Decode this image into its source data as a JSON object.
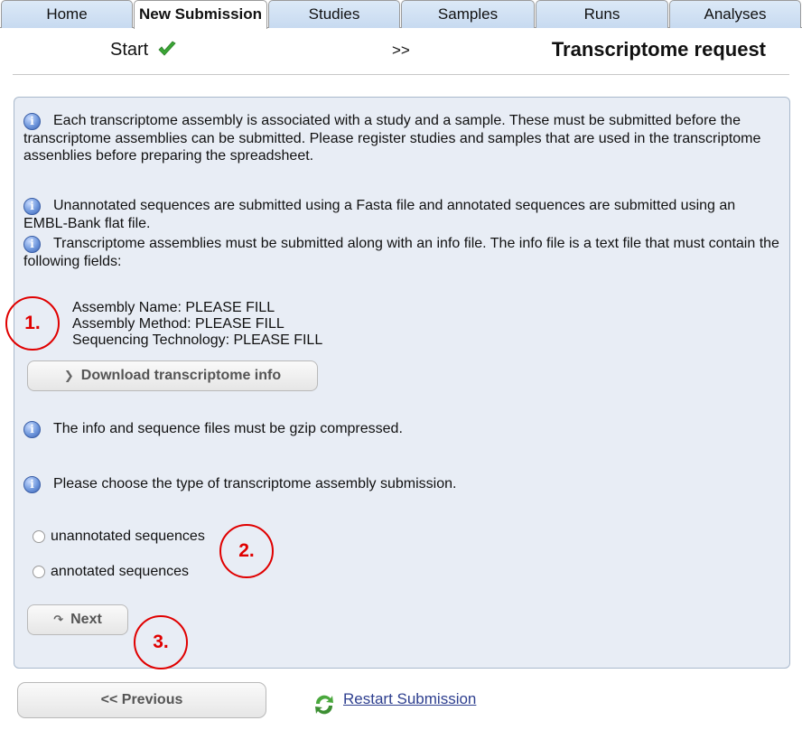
{
  "tabs": [
    {
      "label": "Home"
    },
    {
      "label": "New Submission"
    },
    {
      "label": "Studies"
    },
    {
      "label": "Samples"
    },
    {
      "label": "Runs"
    },
    {
      "label": "Analyses"
    }
  ],
  "steps": {
    "start": "Start",
    "separator": ">>",
    "current": "Transcriptome request"
  },
  "panel": {
    "para1": "Each transcriptome assembly is associated with a study and a sample. These must be submitted before the transcriptome assemblies can be submitted. Please register studies and samples that are used in the transcriptome assenblies before preparing the spreadsheet.",
    "para2": "Unannotated sequences are submitted using a Fasta file and annotated sequences are submitted using an EMBL-Bank flat file.",
    "para3": "Transcriptome assemblies must be submitted along with an info file. The info file is a text file that must contain the following fields:",
    "fields": [
      "Assembly Name: PLEASE FILL",
      "Assembly Method: PLEASE FILL",
      "Sequencing Technology: PLEASE FILL"
    ],
    "download_label": "Download transcriptome info",
    "para4": "The info and sequence files must be gzip compressed.",
    "para5": "Please choose the type of transcriptome assembly submission.",
    "options": [
      {
        "label": "unannotated sequences"
      },
      {
        "label": "annotated sequences"
      }
    ],
    "next_label": "Next"
  },
  "bottom": {
    "previous_label": "<< Previous",
    "restart_label": "Restart Submission"
  },
  "annotations": [
    "1.",
    "2.",
    "3."
  ],
  "icons": {
    "check": "check-icon",
    "info": "info-icon",
    "download": "chevron-down-icon",
    "next": "redo-arrow-icon",
    "restart": "refresh-icon"
  },
  "colors": {
    "panel_bg": "#e8edf5",
    "tab_bg": "#c7daf0",
    "annotation": "#e00000",
    "link": "#2e3f8f",
    "check": "#3aa635"
  }
}
